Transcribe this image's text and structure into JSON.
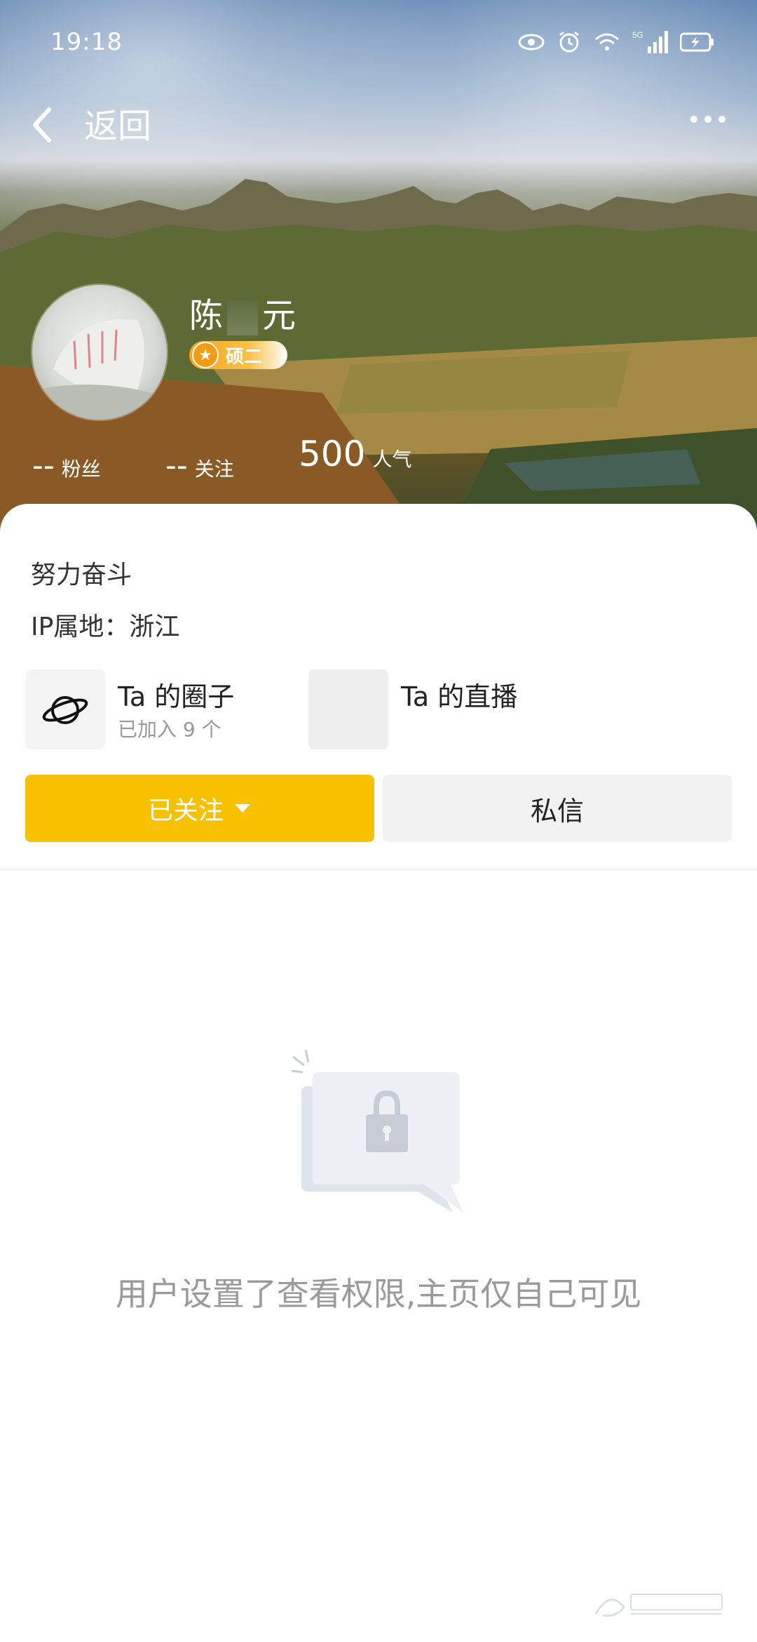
{
  "status_bar": {
    "time": "19:18",
    "icons": [
      "eye-icon",
      "alarm-icon",
      "wifi-icon",
      "signal-5g-icon",
      "battery-charging-icon"
    ],
    "network_label": "5G"
  },
  "header": {
    "back_label": "返回",
    "more_icon": "more-dots-icon"
  },
  "profile": {
    "name_first": "陈",
    "name_last": "元",
    "badge_label": "硕二",
    "stats": {
      "fans_value": "--",
      "fans_label": "粉丝",
      "following_value": "--",
      "following_label": "关注",
      "popularity_value": "500",
      "popularity_label": "人气"
    }
  },
  "info": {
    "bio": "努力奋斗",
    "ip_location": "IP属地：浙江"
  },
  "tiles": {
    "circle_title": "Ta 的圈子",
    "circle_sub": "已加入 9 个",
    "live_title": "Ta 的直播"
  },
  "actions": {
    "follow_label": "已关注",
    "message_label": "私信"
  },
  "empty_state": {
    "message": "用户设置了查看权限,主页仅自己可见"
  },
  "colors": {
    "accent": "#f8c100",
    "badge": "#f39c12",
    "muted_text": "#9a9a9a"
  }
}
